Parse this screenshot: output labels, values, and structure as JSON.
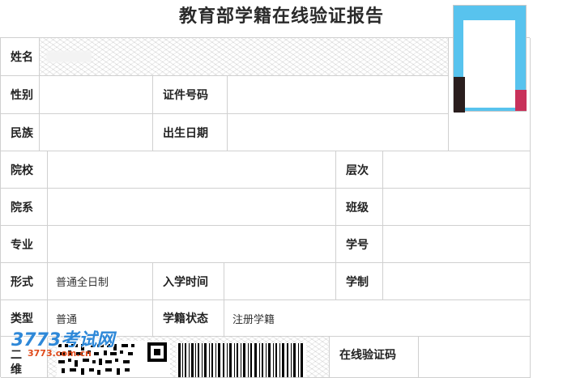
{
  "page": {
    "title": "教育部学籍在线验证报告"
  },
  "labels": {
    "name": "姓名",
    "gender": "性别",
    "id_number": "证件号码",
    "ethnicity": "民族",
    "birth_date": "出生日期",
    "school": "院校",
    "level": "层次",
    "department": "院系",
    "class": "班级",
    "major": "专业",
    "student_id": "学号",
    "form": "形式",
    "enroll_time": "入学时间",
    "duration": "学制",
    "type": "类型",
    "status": "学籍状态",
    "qr_label_1": "二",
    "qr_label_2": "维",
    "verify_code": "在线验证码"
  },
  "values": {
    "form": "普通全日制",
    "type": "普通",
    "status": "注册学籍"
  },
  "watermark": {
    "main": "3773考试网",
    "sub": "3773.com.cn"
  },
  "colors": {
    "watermark_blue": "#2e88d8",
    "watermark_orange": "#e04a1a",
    "photo_bg": "#58c3ee"
  }
}
